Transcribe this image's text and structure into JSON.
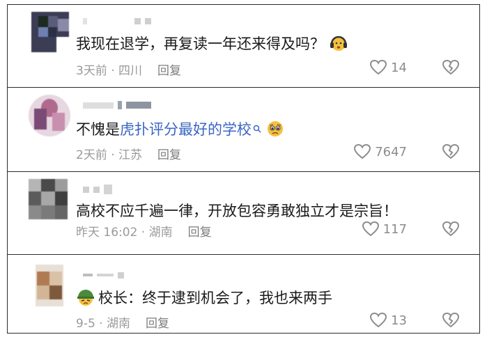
{
  "comments": [
    {
      "text": "我现在退学，再复读一年还来得及吗？",
      "meta": "3天前 · 四川",
      "reply_label": "回复",
      "likes": "14",
      "emoji_icon": "headphones-face-emoji"
    },
    {
      "text_prefix": "不愧是",
      "link_text": "虎扑评分最好的学校",
      "meta": "2天前 · 江苏",
      "reply_label": "回复",
      "likes": "7647",
      "emoji_icon": "pleading-face-emoji"
    },
    {
      "text": "高校不应千遍一律，开放包容勇敢独立才是宗旨！",
      "meta": "昨天 16:02 · 湖南",
      "reply_label": "回复",
      "likes": "117"
    },
    {
      "text": "校长：终于逮到机会了，我也来两手",
      "meta": "9-5 · 湖南",
      "reply_label": "回复",
      "likes": "13",
      "emoji_icon": "helmet-face-emoji"
    }
  ],
  "colors": {
    "link": "#3a66c4",
    "meta": "#9a9a9a",
    "border": "#2a2a2a"
  }
}
